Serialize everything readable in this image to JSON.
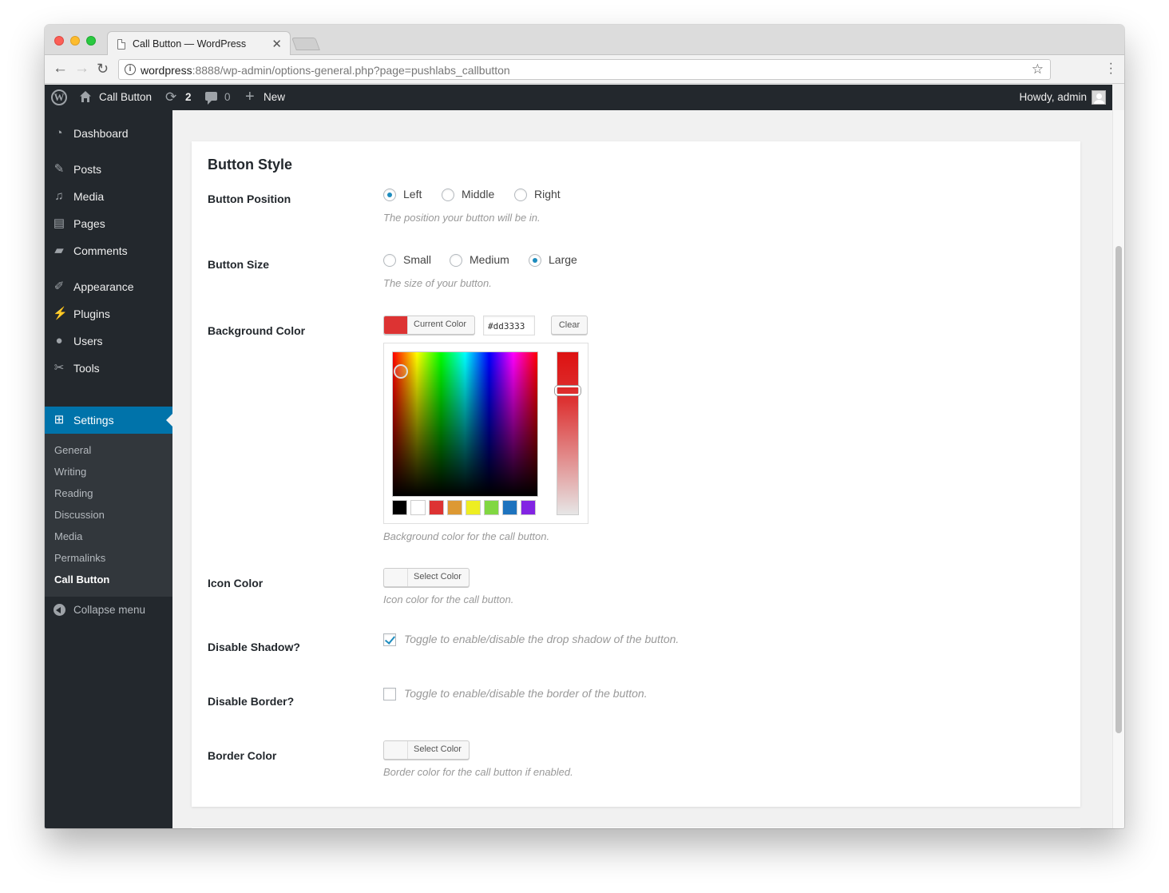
{
  "browser": {
    "tab_title": "Call Button — WordPress",
    "tab_close": "✕",
    "url_host": "wordpress",
    "url_rest": ":8888/wp-admin/options-general.php?page=pushlabs_callbutton"
  },
  "adminbar": {
    "site_name": "Call Button",
    "updates_count": "2",
    "comments_count": "0",
    "new_label": "New",
    "howdy": "Howdy, admin"
  },
  "sidebar": {
    "items": [
      {
        "label": "Dashboard",
        "icon": "dashboard-icon"
      },
      {
        "label": "Posts",
        "icon": "pin-icon"
      },
      {
        "label": "Media",
        "icon": "media-icon"
      },
      {
        "label": "Pages",
        "icon": "pages-icon"
      },
      {
        "label": "Comments",
        "icon": "comment-icon"
      },
      {
        "label": "Appearance",
        "icon": "brush-icon"
      },
      {
        "label": "Plugins",
        "icon": "plug-icon"
      },
      {
        "label": "Users",
        "icon": "user-icon"
      },
      {
        "label": "Tools",
        "icon": "wrench-icon"
      },
      {
        "label": "Settings",
        "icon": "settings-icon",
        "current": true
      }
    ],
    "submenu": [
      "General",
      "Writing",
      "Reading",
      "Discussion",
      "Media",
      "Permalinks",
      "Call Button"
    ],
    "collapse_label": "Collapse menu"
  },
  "main": {
    "section_title": "Button Style",
    "position": {
      "label": "Button Position",
      "options": [
        "Left",
        "Middle",
        "Right"
      ],
      "selected": "Left",
      "description": "The position your button will be in."
    },
    "size": {
      "label": "Button Size",
      "options": [
        "Small",
        "Medium",
        "Large"
      ],
      "selected": "Large",
      "description": "The size of your button."
    },
    "background_color": {
      "label": "Background Color",
      "button_label": "Current Color",
      "value": "#dd3333",
      "clear_label": "Clear",
      "palette": [
        "#000000",
        "#ffffff",
        "#dd3333",
        "#dd9933",
        "#eeee22",
        "#81d742",
        "#1e73be",
        "#8224e3"
      ],
      "description": "Background color for the call button."
    },
    "icon_color": {
      "label": "Icon Color",
      "button_label": "Select Color",
      "description": "Icon color for the call button."
    },
    "disable_shadow": {
      "label": "Disable Shadow?",
      "checked": true,
      "description": "Toggle to enable/disable the drop shadow of the button."
    },
    "disable_border": {
      "label": "Disable Border?",
      "checked": false,
      "description": "Toggle to enable/disable the border of the button."
    },
    "border_color": {
      "label": "Border Color",
      "button_label": "Select Color",
      "description": "Border color for the call button if enabled."
    }
  },
  "colors": {
    "admin_dark": "#23282d",
    "admin_accent": "#0073aa",
    "radio_accent": "#1e8cbe"
  }
}
